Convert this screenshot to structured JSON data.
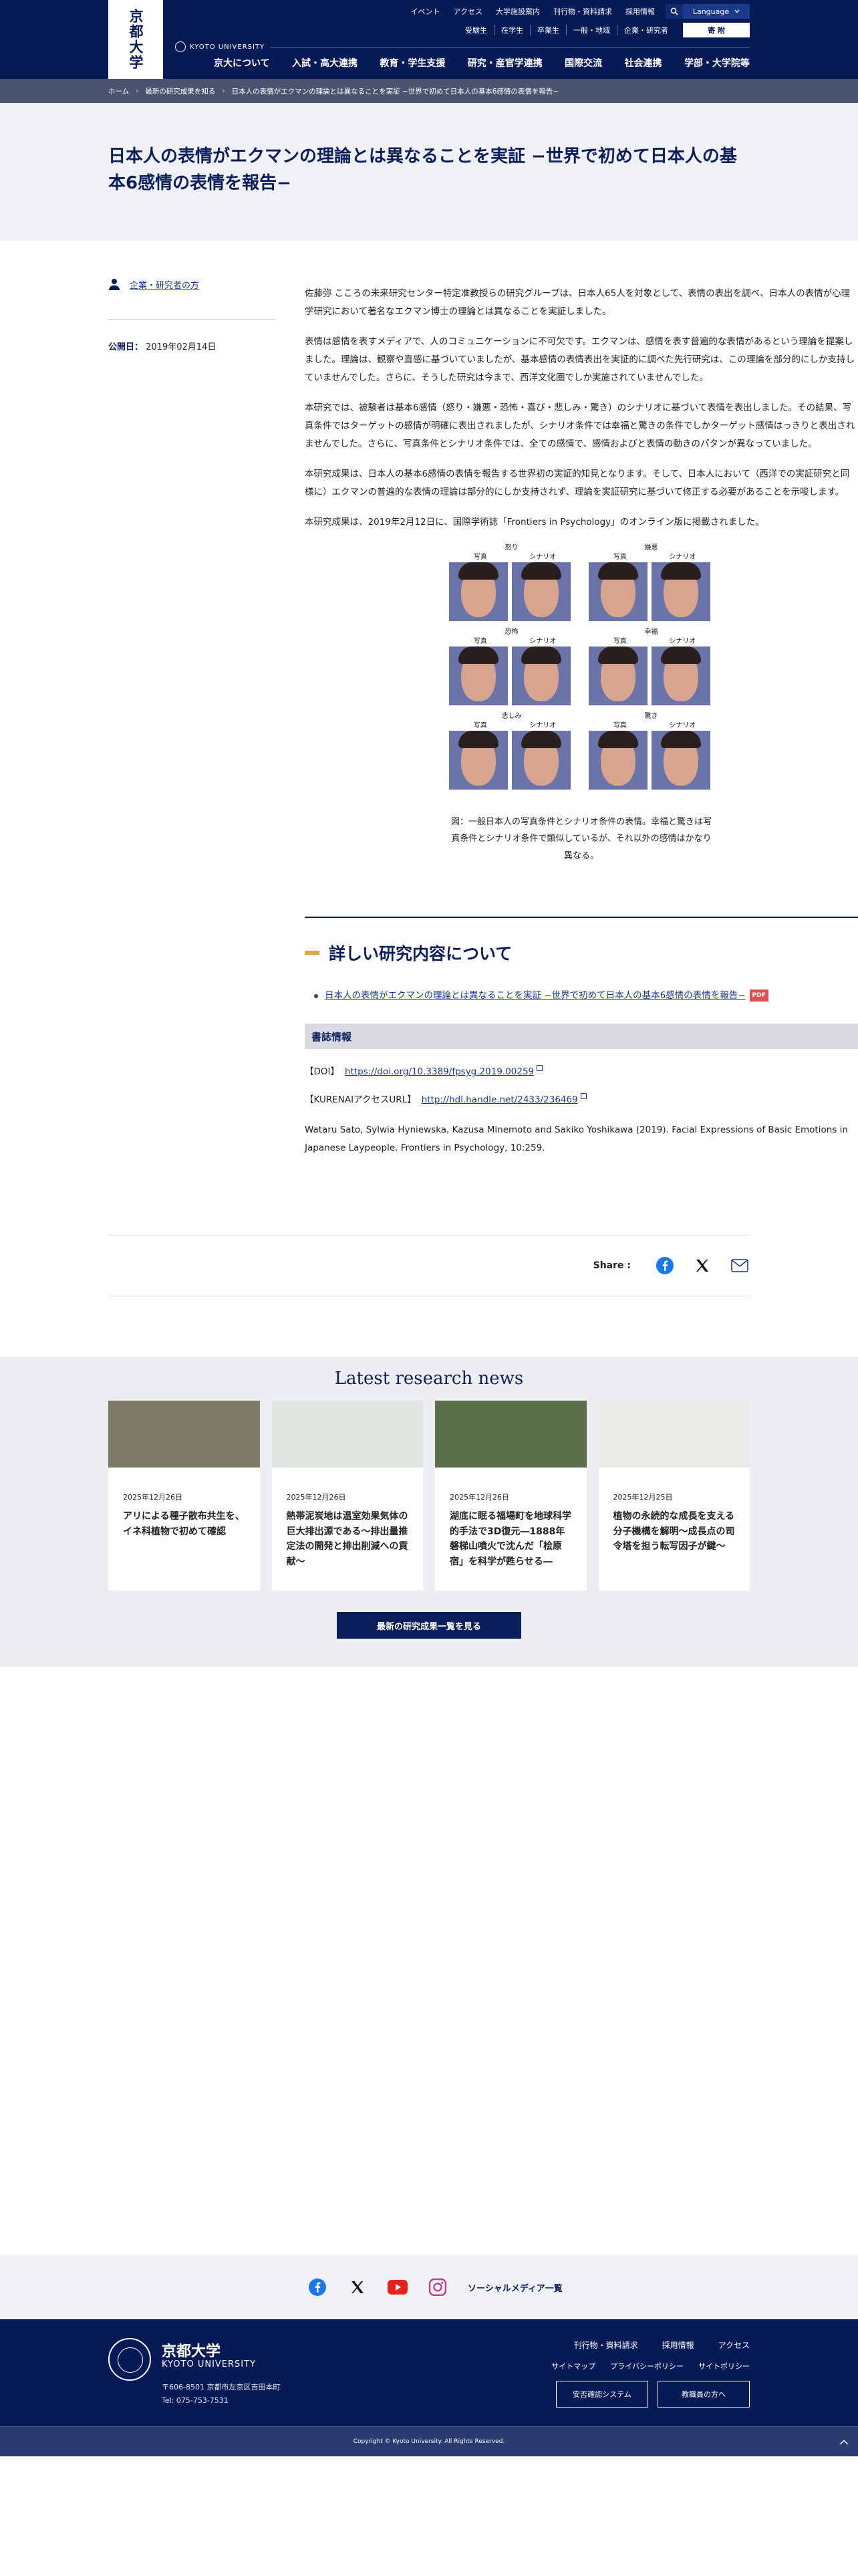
{
  "header": {
    "logo": "京都大学",
    "ku_en": "KYOTO UNIVERSITY",
    "util_nav": [
      "イベント",
      "アクセス",
      "大学施設案内",
      "刊行物・資料請求",
      "採用情報"
    ],
    "language": "Language",
    "audience_nav": [
      "受験生",
      "在学生",
      "卒業生",
      "一般・地域",
      "企業・研究者"
    ],
    "donate": "寄 附",
    "main_nav": [
      "京大について",
      "入試・高大連携",
      "教育・学生支援",
      "研究・産官学連携",
      "国際交流",
      "社会連携",
      "学部・大学院等"
    ]
  },
  "breadcrumb": [
    "ホーム",
    "最新の研究成果を知る",
    "日本人の表情がエクマンの理論とは異なることを実証 −世界で初めて日本人の基本6感情の表情を報告−"
  ],
  "page_title": "日本人の表情がエクマンの理論とは異なることを実証 −世界で初めて日本人の基本6感情の表情を報告−",
  "sidebar": {
    "tag": "企業・研究者の方",
    "date_label": "公開日：",
    "date": "2019年02月14日"
  },
  "body": {
    "p1": "佐藤弥 こころの未来研究センター特定准教授らの研究グループは、日本人65人を対象として、表情の表出を調べ、日本人の表情が心理学研究において著名なエクマン博士の理論とは異なることを実証しました。",
    "p2": "表情は感情を表すメディアで、人のコミュニケーションに不可欠です。エクマンは、感情を表す普遍的な表情があるという理論を提案しました。理論は、観察や直感に基づいていましたが、基本感情の表情表出を実証的に調べた先行研究は、この理論を部分的にしか支持していませんでした。さらに、そうした研究は今まで、西洋文化圏でしか実施されていませんでした。",
    "p3": "本研究では、被験者は基本6感情（怒り・嫌悪・恐怖・喜び・悲しみ・驚き）のシナリオに基づいて表情を表出しました。その結果、写真条件ではターゲットの感情が明確に表出されましたが、シナリオ条件では幸福と驚きの条件でしかターゲット感情はっきりと表出されませんでした。さらに、写真条件とシナリオ条件では、全ての感情で、感情およびと表情の動きのパタンが異なっていました。",
    "p4": "本研究成果は、日本人の基本6感情の表情を報告する世界初の実証的知見となります。そして、日本人において（西洋での実証研究と同様に）エクマンの普遍的な表情の理論は部分的にしか支持されず、理論を実証研究に基づいて修正する必要があることを示唆します。",
    "p5": "本研究成果は、2019年2月12日に、国際学術誌「Frontiers in Psychology」のオンライン版に掲載されました。"
  },
  "figure": {
    "photo_label": "写真",
    "scenario_label": "シナリオ",
    "emotions": [
      "怒り",
      "嫌悪",
      "恐怖",
      "幸福",
      "悲しみ",
      "驚き"
    ],
    "caption": "図：一般日本人の写真条件とシナリオ条件の表情。幸福と驚きは写真条件とシナリオ条件で類似しているが、それ以外の感情はかなり異なる。"
  },
  "details": {
    "heading": "詳しい研究内容について",
    "link": "日本人の表情がエクマンの理論とは異なることを実証 −世界で初めて日本人の基本6感情の表情を報告−",
    "pdf": "PDF",
    "bib_heading": "書誌情報",
    "doi_label": "【DOI】",
    "doi_url": "https://doi.org/10.3389/fpsyg.2019.00259",
    "kurenai_label": "【KURENAIアクセスURL】",
    "kurenai_url": "http://hdl.handle.net/2433/236469",
    "citation": "Wataru Sato, Sylwia Hyniewska, Kazusa Minemoto and Sakiko Yoshikawa (2019). Facial Expressions of Basic Emotions in Japanese Laypeople. Frontiers in Psychology, 10:259."
  },
  "share": {
    "label": "Share :"
  },
  "news": {
    "heading": "Latest research news",
    "cards": [
      {
        "date": "2025年12月26日",
        "title": "アリによる種子散布共生を、イネ科植物で初めて確認",
        "color": "#7d7a6a"
      },
      {
        "date": "2025年12月26日",
        "title": "熱帯泥炭地は温室効果気体の巨大排出源である〜排出量推定法の開発と排出削減への貢献〜",
        "color": "#dfe6e0"
      },
      {
        "date": "2025年12月26日",
        "title": "湖底に眠る福場町を地球科学的手法で3D復元―1888年磐梯山噴火で沈んだ「桧原宿」を科学が甦らせる―",
        "color": "#5a6e4a"
      },
      {
        "date": "2025年12月25日",
        "title": "植物の永続的な成長を支える分子機構を解明〜成長点の司令塔を担う転写因子が鍵〜",
        "color": "#e8ece4"
      }
    ],
    "more": "最新の研究成果一覧を見る"
  },
  "social": {
    "link": "ソーシャルメディア一覧"
  },
  "footer": {
    "name_ja": "京都大学",
    "name_en": "KYOTO UNIVERSITY",
    "address": "〒606-8501 京都市左京区吉田本町",
    "tel": "Tel: 075-753-7531",
    "links1": [
      "刊行物・資料請求",
      "採用情報",
      "アクセス"
    ],
    "links2": [
      "サイトマップ",
      "プライバシーポリシー",
      "サイトポリシー"
    ],
    "btn1": "安否確認システム",
    "btn2": "教職員の方へ",
    "copyright": "Copyright © Kyoto University. All Rights Reserved."
  }
}
